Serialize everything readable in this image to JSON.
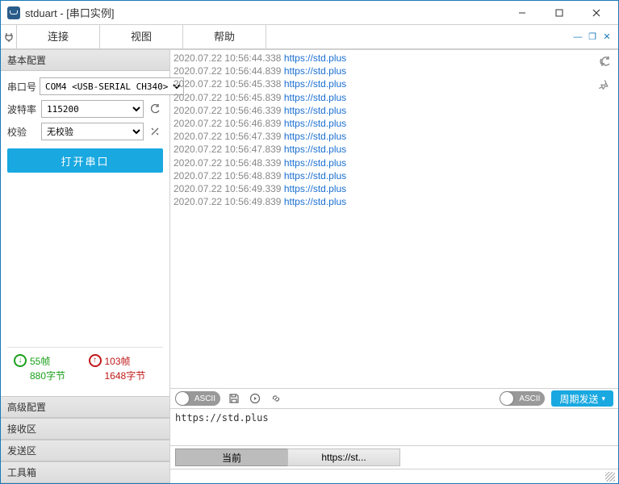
{
  "window": {
    "title": "stduart - [串口实例]"
  },
  "menu": {
    "connect": "连接",
    "view": "视图",
    "help": "帮助"
  },
  "sidebar": {
    "basic_header": "基本配置",
    "port_label": "串口号",
    "port_value": "COM4 <USB-SERIAL CH340>",
    "baud_label": "波特率",
    "baud_value": "115200",
    "parity_label": "校验",
    "parity_value": "无校验",
    "open_button": "打开串口",
    "stats": {
      "tx_frames": "55帧",
      "tx_bytes": "880字节",
      "rx_frames": "103帧",
      "rx_bytes": "1648字节"
    },
    "adv_header": "高级配置",
    "recv_header": "接收区",
    "send_header": "发送区",
    "toolbox_header": "工具箱"
  },
  "log": {
    "lines": [
      {
        "ts": "2020.07.22 10:56:44.338",
        "link": "https://std.plus"
      },
      {
        "ts": "2020.07.22 10:56:44.839",
        "link": "https://std.plus"
      },
      {
        "ts": "2020.07.22 10:56:45.338",
        "link": "https://std.plus"
      },
      {
        "ts": "2020.07.22 10:56:45.839",
        "link": "https://std.plus"
      },
      {
        "ts": "2020.07.22 10:56:46.339",
        "link": "https://std.plus"
      },
      {
        "ts": "2020.07.22 10:56:46.839",
        "link": "https://std.plus"
      },
      {
        "ts": "2020.07.22 10:56:47.339",
        "link": "https://std.plus"
      },
      {
        "ts": "2020.07.22 10:56:47.839",
        "link": "https://std.plus"
      },
      {
        "ts": "2020.07.22 10:56:48.339",
        "link": "https://std.plus"
      },
      {
        "ts": "2020.07.22 10:56:48.839",
        "link": "https://std.plus"
      },
      {
        "ts": "2020.07.22 10:56:49.339",
        "link": "https://std.plus"
      },
      {
        "ts": "2020.07.22 10:56:49.839",
        "link": "https://std.plus"
      }
    ]
  },
  "midbar": {
    "ascii_left": "ASCII",
    "ascii_right": "ASCII",
    "period_send": "周期发送"
  },
  "send_text": "https://std.plus",
  "tabs": {
    "current": "当前",
    "second": "https://st..."
  }
}
